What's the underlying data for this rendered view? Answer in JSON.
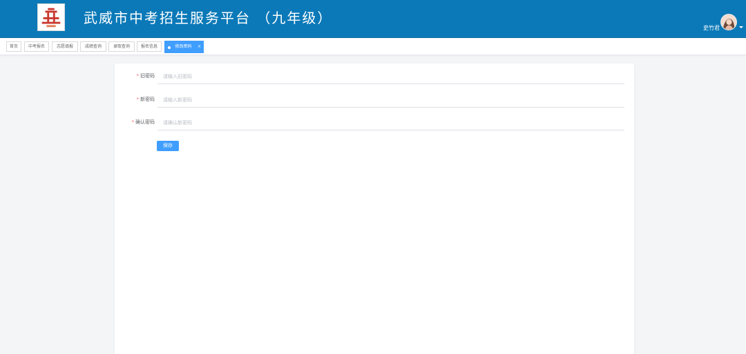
{
  "header": {
    "title": "武威市中考招生服务平台 （九年级）",
    "user_name": "史竹君",
    "logo_icon": "school-logo",
    "avatar_icon": "user-avatar",
    "background_color": "#0b79b8"
  },
  "tabs": [
    {
      "label": "首页"
    },
    {
      "label": "中考报名"
    },
    {
      "label": "志愿填报"
    },
    {
      "label": "成绩查询"
    },
    {
      "label": "录取查询"
    },
    {
      "label": "报名信息"
    },
    {
      "label": "修改密码",
      "active": true
    }
  ],
  "form": {
    "fields": [
      {
        "label": "旧密码",
        "required": true,
        "placeholder": "请输入旧密码",
        "value": ""
      },
      {
        "label": "新密码",
        "required": true,
        "placeholder": "请输入新密码",
        "value": ""
      },
      {
        "label": "确认密码",
        "required": true,
        "placeholder": "请确认新密码",
        "value": ""
      }
    ],
    "save_label": "保存"
  },
  "colors": {
    "primary": "#409eff",
    "required": "#f56c6c"
  }
}
